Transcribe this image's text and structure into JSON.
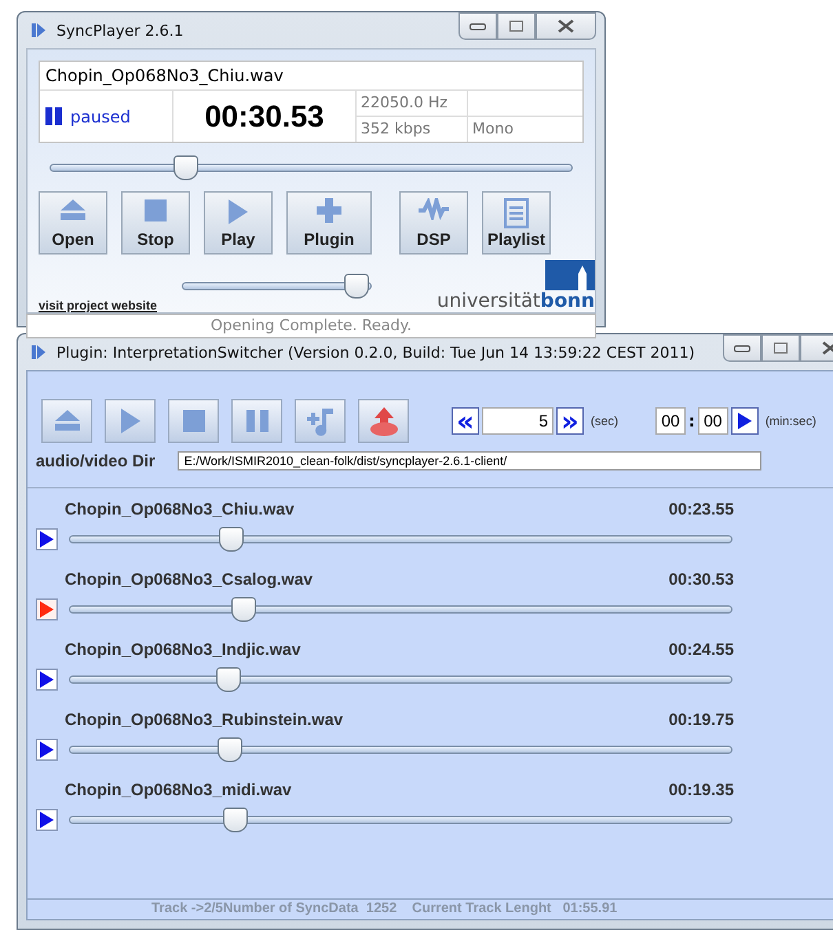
{
  "player": {
    "title": "SyncPlayer 2.6.1",
    "file": "Chopin_Op068No3_Chiu.wav",
    "status": "paused",
    "time": "00:30.53",
    "frequency": "22050.0 Hz",
    "bitrate": "352 kbps",
    "channels": "Mono",
    "position": {
      "level": 0.26
    },
    "buttons": [
      {
        "kind": "eject",
        "label": "Open"
      },
      {
        "kind": "stop",
        "label": "Stop"
      },
      {
        "kind": "play",
        "label": "Play"
      },
      {
        "kind": "plus",
        "label": "Plugin"
      },
      {
        "kind": "wave",
        "label": "DSP"
      },
      {
        "kind": "list",
        "label": "Playlist"
      }
    ],
    "link": "visit project website",
    "volume": {
      "level": 0.92
    },
    "logo": {
      "first": "universität",
      "second": "bonn"
    },
    "status_bar": "Opening Complete. Ready."
  },
  "plugin": {
    "title": "Plugin: InterpretationSwitcher (Version 0.2.0, Build: Tue Jun 14 13:59:22 CEST 2011)",
    "toolbar": [
      {
        "kind": "eject"
      },
      {
        "kind": "play"
      },
      {
        "kind": "stop"
      },
      {
        "kind": "pause"
      },
      {
        "kind": "note"
      },
      {
        "kind": "upload"
      }
    ],
    "skip": {
      "back": "«",
      "value": "5",
      "forward": "»",
      "unit": "(sec)"
    },
    "goto": {
      "minutes": "00",
      "separator": ":",
      "seconds": "00",
      "unit": "(min:sec)"
    },
    "dir": {
      "label": "audio/video Dir",
      "value": "E:/Work/ISMIR2010_clean-folk/dist/syncplayer-2.6.1-client/"
    },
    "tracks": [
      {
        "name": "Chopin_Op068No3_Chiu.wav",
        "time": "00:23.55",
        "level": 0.245,
        "selected": false
      },
      {
        "name": "Chopin_Op068No3_Csalog.wav",
        "time": "00:30.53",
        "level": 0.263,
        "selected": true
      },
      {
        "name": "Chopin_Op068No3_Indjic.wav",
        "time": "00:24.55",
        "level": 0.24,
        "selected": false
      },
      {
        "name": "Chopin_Op068No3_Rubinstein.wav",
        "time": "00:19.75",
        "level": 0.242,
        "selected": false
      },
      {
        "name": "Chopin_Op068No3_midi.wav",
        "time": "00:19.35",
        "level": 0.252,
        "selected": false
      }
    ],
    "status_bar": "Track ->2/5Number of SyncData  1252    Current Track Lenght   01:55.91"
  }
}
